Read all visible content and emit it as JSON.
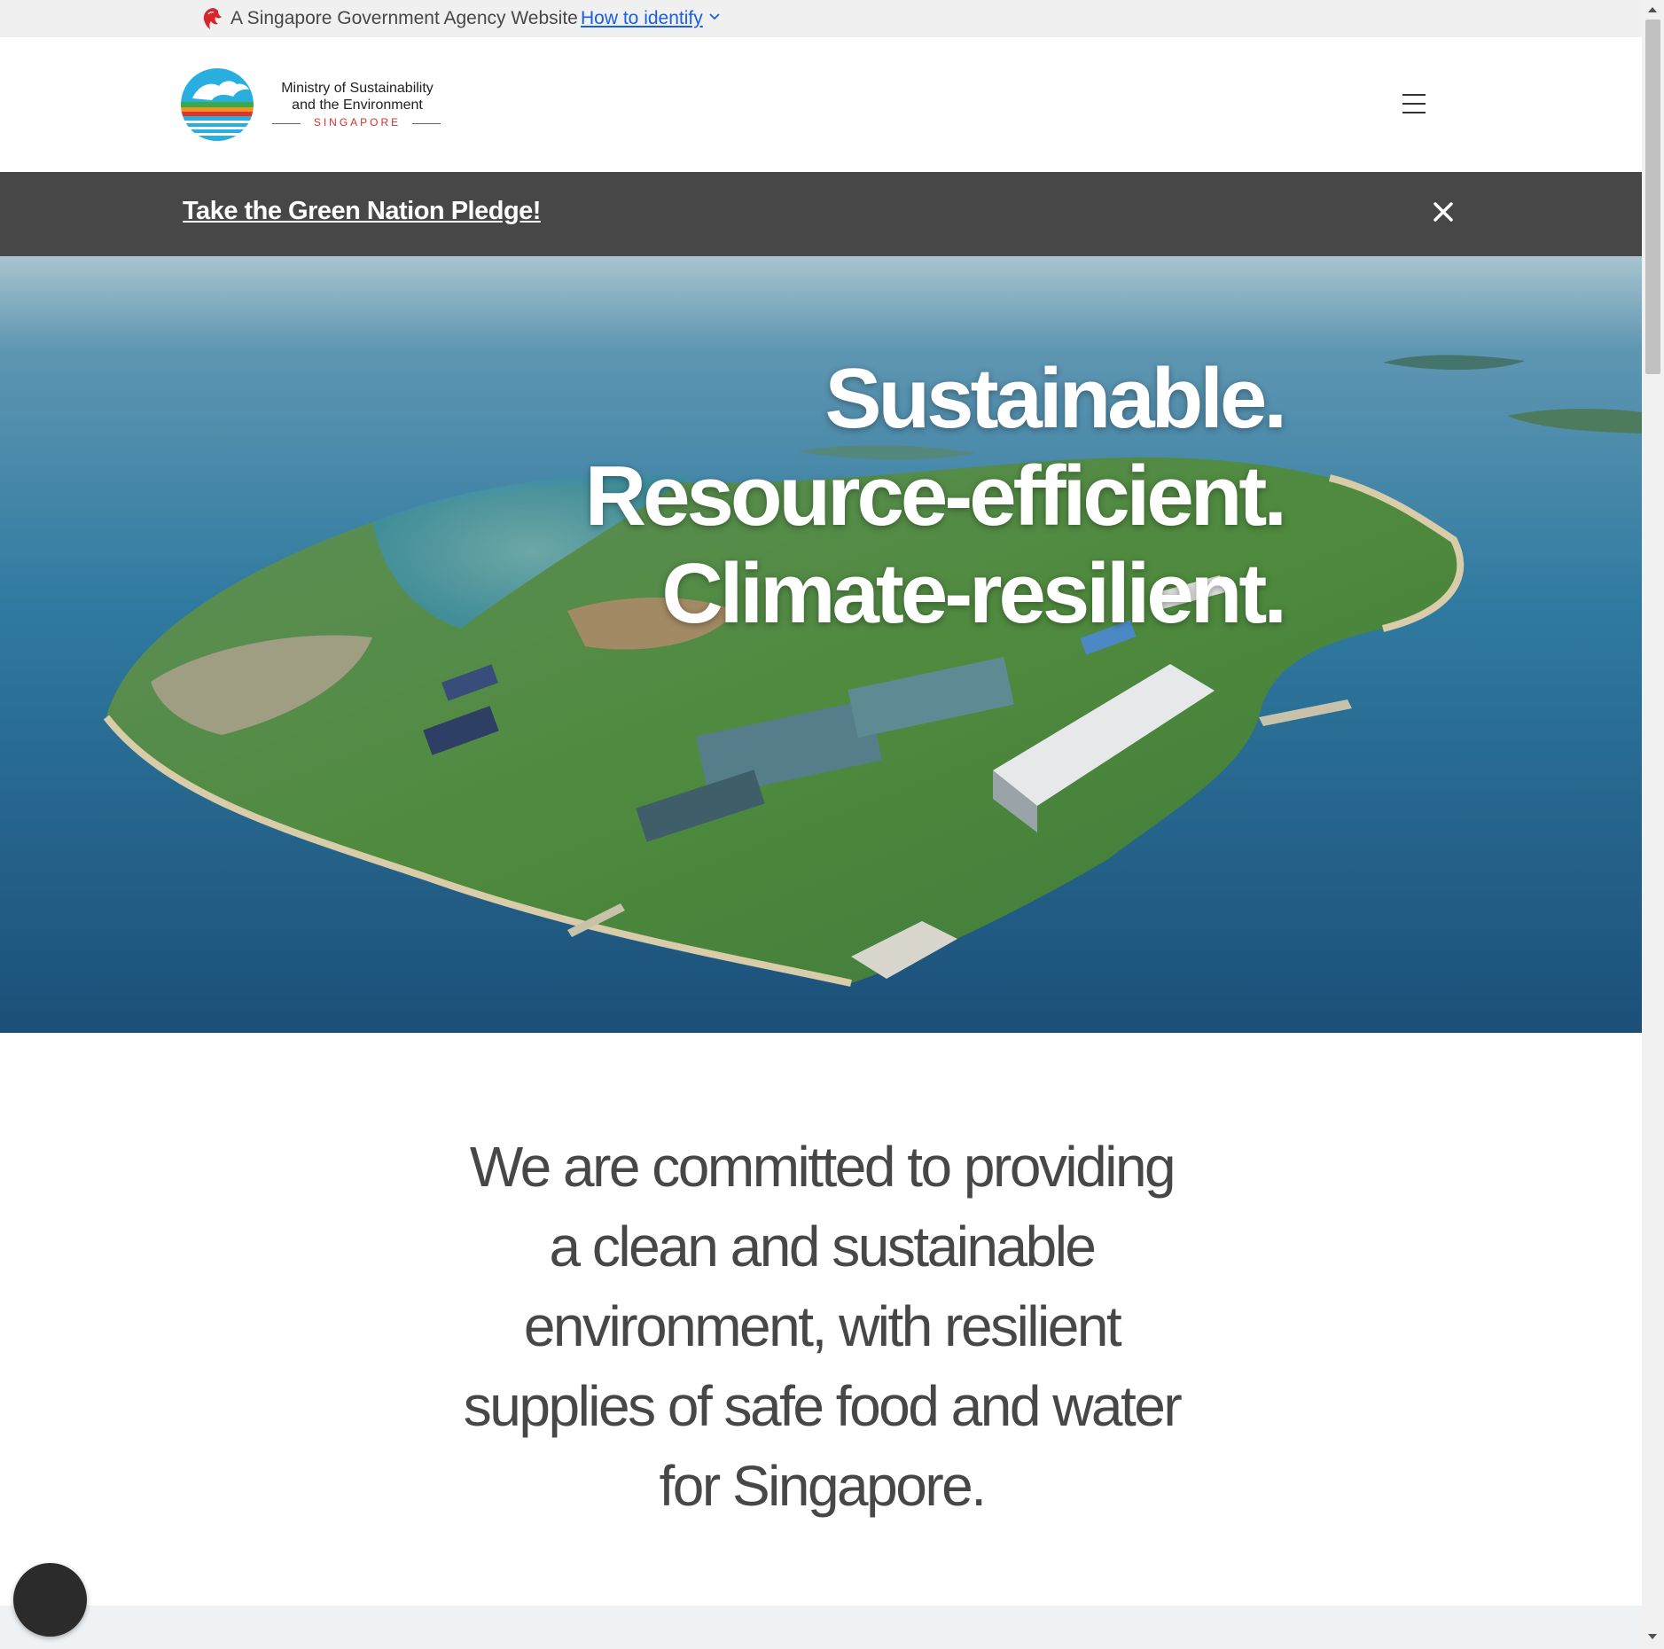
{
  "masthead": {
    "agency_text": "A Singapore Government Agency Website",
    "identify_link": "How to identify"
  },
  "header": {
    "logo_line1": "Ministry of Sustainability",
    "logo_line2": "and the Environment",
    "logo_country": "SINGAPORE",
    "menu_icon": "hamburger-icon"
  },
  "announcement": {
    "link_text": "Take the Green Nation Pledge!",
    "close_icon": "close-icon"
  },
  "hero": {
    "taglines": [
      "Sustainable.",
      "Resource-efficient.",
      "Climate-resilient."
    ]
  },
  "mission": {
    "lines": [
      "We are committed to providing",
      "a clean and sustainable",
      "environment, with resilient",
      "supplies of safe food and water",
      "for Singapore."
    ]
  },
  "colors": {
    "masthead_bg": "#f0f0f0",
    "link_blue": "#1a5ee2",
    "announcement_bg": "#474747",
    "text_dark": "#474747",
    "brand_red": "#d32f2f"
  }
}
